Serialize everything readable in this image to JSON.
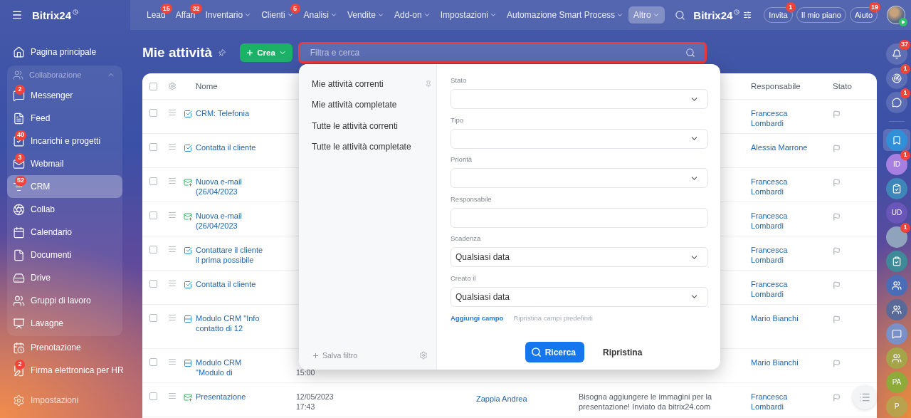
{
  "topbar": {
    "logo": "Bitrix24",
    "nav": [
      {
        "label": "Lead",
        "badge": "15",
        "dropdown": false,
        "selected": false
      },
      {
        "label": "Affari",
        "badge": "32",
        "dropdown": false,
        "selected": false
      },
      {
        "label": "Inventario",
        "dropdown": true,
        "selected": false
      },
      {
        "label": "Clienti",
        "badge": "5",
        "dropdown": true,
        "selected": false
      },
      {
        "label": "Analisi",
        "dropdown": true,
        "selected": false
      },
      {
        "label": "Vendite",
        "dropdown": true,
        "selected": false
      },
      {
        "label": "Add-on",
        "dropdown": true,
        "selected": false
      },
      {
        "label": "Impostazioni",
        "dropdown": true,
        "selected": false
      },
      {
        "label": "Automazione Smart Process",
        "dropdown": true,
        "selected": false
      },
      {
        "label": "Altro",
        "dropdown": true,
        "selected": true
      }
    ],
    "brand": "Bitrix24",
    "buttons": [
      {
        "label": "Invita",
        "badge": "1"
      },
      {
        "label": "Il mio piano"
      },
      {
        "label": "Aiuto",
        "badge": "19"
      }
    ]
  },
  "sidebar": {
    "top": [
      {
        "label": "Pagina principale",
        "selected": false
      }
    ],
    "group": {
      "label": "Collaborazione",
      "expanded": true,
      "items": [
        {
          "label": "Messenger",
          "badge": "2",
          "selected": false
        },
        {
          "label": "Feed",
          "selected": false
        },
        {
          "label": "Incarichi e progetti",
          "badge": "40",
          "selected": false
        },
        {
          "label": "Webmail",
          "badge": "3",
          "selected": false
        },
        {
          "label": "CRM",
          "badge": "52",
          "selected": true
        },
        {
          "label": "Collab",
          "selected": false
        },
        {
          "label": "Calendario",
          "selected": false
        },
        {
          "label": "Documenti",
          "selected": false
        },
        {
          "label": "Drive",
          "selected": false
        },
        {
          "label": "Gruppi di lavoro",
          "selected": false
        },
        {
          "label": "Lavagne",
          "selected": false
        }
      ]
    },
    "bottom": [
      {
        "label": "Prenotazione",
        "selected": false
      },
      {
        "label": "Firma elettronica per HR",
        "badge": "2",
        "selected": false
      }
    ],
    "settings": "Impostazioni"
  },
  "page": {
    "title": "Mie attività",
    "create": "Crea",
    "search": {
      "placeholder": "Filtra e cerca",
      "highlighted": true
    }
  },
  "table": {
    "header": {
      "name": "Nome",
      "responsible": "Responsabile",
      "status": "Stato",
      "checked": false
    },
    "rows": [
      {
        "kind": "task",
        "name": "CRM: Telefonia",
        "responsible": "Francesca Lombardi",
        "checked": false
      },
      {
        "kind": "task",
        "name": "Contatta il cliente",
        "responsible": "Alessia Marrone",
        "checked": false
      },
      {
        "kind": "email",
        "name": "Nuova e-mail\n(26/04/2023",
        "responsible": "Francesca Lombardi",
        "checked": false
      },
      {
        "kind": "email",
        "name": "Nuova e-mail\n(26/04/2023",
        "responsible": "Francesca Lombardi",
        "checked": false
      },
      {
        "kind": "task",
        "name": "Contattare il cliente\nil prima possibile",
        "responsible": "Francesca Lombardi",
        "checked": false
      },
      {
        "kind": "task",
        "name": "Contatta il cliente",
        "responsible": "Francesca Lombardi",
        "checked": false
      },
      {
        "kind": "form",
        "name": "Modulo CRM \"Info\ncontatto di 12",
        "responsible": "Mario Bianchi",
        "checked": false
      },
      {
        "kind": "form",
        "name": "Modulo CRM\n\"Modulo di",
        "date_time": "15:00",
        "responsible": "Mario Bianchi",
        "checked": false
      },
      {
        "kind": "email",
        "name": "Presentazione",
        "date": "12/05/2023",
        "date_time": "17:43",
        "contact": "Zappia Andrea",
        "description": "Bisogna aggiungere le immagini per la presentazione! Inviato da bitrix24.com",
        "responsible": "Francesca Lombardi",
        "checked": false
      }
    ]
  },
  "filter": {
    "presets": [
      {
        "label": "Mie attività correnti",
        "pinned": true
      },
      {
        "label": "Mie attività completate",
        "pinned": false
      },
      {
        "label": "Tutte le attività correnti",
        "pinned": false
      },
      {
        "label": "Tutte le attività completate",
        "pinned": false
      }
    ],
    "save": "Salva filtro",
    "fields": [
      {
        "kind": "select",
        "label": "Stato"
      },
      {
        "kind": "select",
        "label": "Tipo"
      },
      {
        "kind": "select",
        "label": "Priorità"
      },
      {
        "kind": "input",
        "label": "Responsabile"
      },
      {
        "kind": "select",
        "label": "Scadenza",
        "value": "Qualsiasi data"
      },
      {
        "kind": "select",
        "label": "Creato il",
        "value": "Qualsiasi data"
      }
    ],
    "add_field": "Aggiungi campo",
    "reset_fields": "Ripristina campi predefiniti",
    "search": "Ricerca",
    "reset": "Ripristina"
  },
  "rail": {
    "top": [
      {
        "badge": "37"
      },
      {
        "badge": "1"
      },
      {
        "badge": "1"
      }
    ],
    "items": [
      {
        "kind": "icon",
        "color": "#2f8fd8",
        "selected": true
      },
      {
        "kind": "initials",
        "initials": "ID",
        "color": "#a77fe0",
        "badge": "1",
        "selected": false
      },
      {
        "kind": "icon",
        "color": "#3f86b8",
        "selected": false
      },
      {
        "kind": "initials",
        "initials": "UD",
        "color": "#6a55b8",
        "selected": false
      },
      {
        "kind": "avatar",
        "color": "#8fa3bd",
        "badge": "1",
        "selected": false
      },
      {
        "kind": "icon",
        "color": "#3f8a98",
        "selected": false
      },
      {
        "kind": "icon",
        "color": "#4a6db8",
        "selected": false
      },
      {
        "kind": "icon",
        "color": "#5a6a98",
        "selected": false
      },
      {
        "kind": "icon",
        "color": "#7a90c8",
        "selected": false
      },
      {
        "kind": "icon",
        "color": "#a3a548",
        "selected": false
      },
      {
        "kind": "initials",
        "initials": "PA",
        "color": "#8eab3a",
        "selected": false
      },
      {
        "kind": "initials",
        "initials": "P",
        "color": "#b8a24e",
        "selected": false
      }
    ]
  }
}
